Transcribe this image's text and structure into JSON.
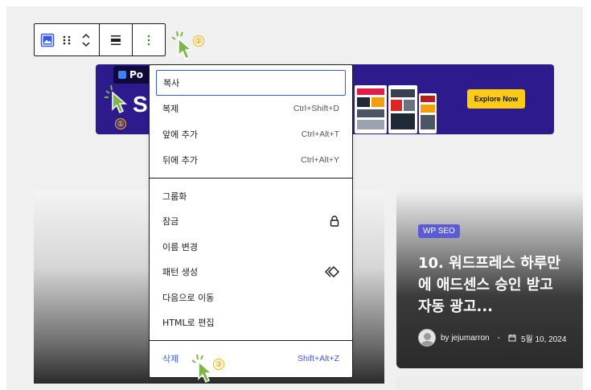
{
  "toolbar": {
    "image_icon": "image-icon",
    "drag_icon": "drag-handle-icon",
    "move_icon": "chevron-up-down-icon",
    "align_icon": "align-icon",
    "options_icon": "more-vertical-icon"
  },
  "banner": {
    "logo_text": "Po",
    "headline_letter": "S",
    "cta_label": "Explore Now"
  },
  "menu": {
    "section1": [
      {
        "label": "복사",
        "shortcut": ""
      },
      {
        "label": "복제",
        "shortcut": "Ctrl+Shift+D"
      },
      {
        "label": "앞에 추가",
        "shortcut": "Ctrl+Alt+T"
      },
      {
        "label": "뒤에 추가",
        "shortcut": "Ctrl+Alt+Y"
      }
    ],
    "section2": [
      {
        "label": "그룹화"
      },
      {
        "label": "잠금",
        "icon": "lock-icon"
      },
      {
        "label": "이름 변경"
      },
      {
        "label": "패턴 생성",
        "icon": "symbol-icon"
      },
      {
        "label": "다음으로 이동"
      },
      {
        "label": "HTML로 편집"
      }
    ],
    "section3": [
      {
        "label": "삭제",
        "shortcut": "Shift+Alt+Z"
      }
    ]
  },
  "post": {
    "badge": "WP SEO",
    "title_line1": "10. 워드프레스 하루만",
    "title_line2": "에 애드센스 승인 받고",
    "title_line3": "자동 광고...",
    "author": "by jejumarron",
    "separator": "-",
    "date": "5월 10, 2024"
  },
  "markers": {
    "one": "①",
    "two": "②",
    "three": "③"
  },
  "colors": {
    "accent": "#3858e9",
    "banner_bg": "#2d1b8e",
    "cta": "#facc15",
    "badge": "#5b5bd6",
    "marker": "#f5b400",
    "cursor_fill": "#7ab648"
  }
}
